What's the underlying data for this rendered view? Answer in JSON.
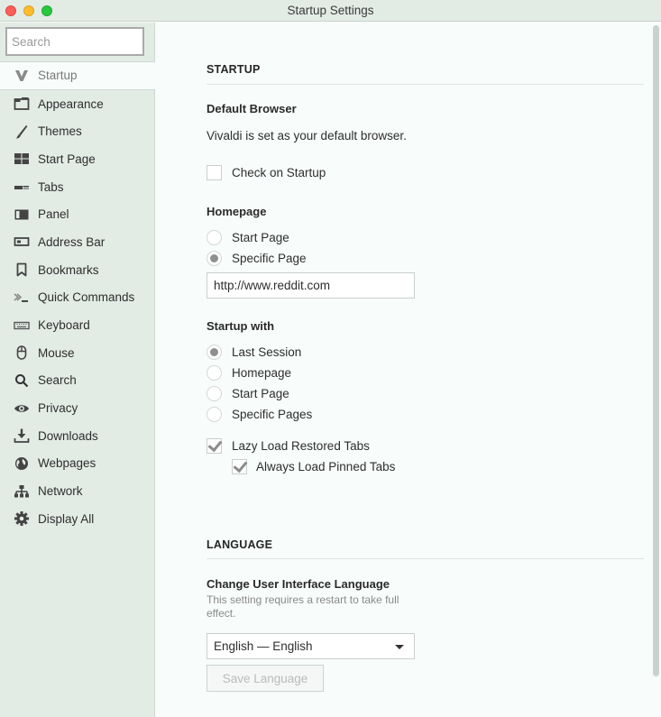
{
  "window": {
    "title": "Startup Settings"
  },
  "sidebar": {
    "search_placeholder": "Search",
    "items": [
      {
        "label": "Startup",
        "icon": "vivaldi-logo-icon",
        "selected": true
      },
      {
        "label": "Appearance",
        "icon": "window-icon"
      },
      {
        "label": "Themes",
        "icon": "brush-icon"
      },
      {
        "label": "Start Page",
        "icon": "grid-icon"
      },
      {
        "label": "Tabs",
        "icon": "tabs-icon"
      },
      {
        "label": "Panel",
        "icon": "panel-icon"
      },
      {
        "label": "Address Bar",
        "icon": "address-bar-icon"
      },
      {
        "label": "Bookmarks",
        "icon": "bookmark-icon"
      },
      {
        "label": "Quick Commands",
        "icon": "terminal-icon"
      },
      {
        "label": "Keyboard",
        "icon": "keyboard-icon"
      },
      {
        "label": "Mouse",
        "icon": "mouse-icon"
      },
      {
        "label": "Search",
        "icon": "search-icon"
      },
      {
        "label": "Privacy",
        "icon": "eye-icon"
      },
      {
        "label": "Downloads",
        "icon": "download-icon"
      },
      {
        "label": "Webpages",
        "icon": "globe-icon"
      },
      {
        "label": "Network",
        "icon": "network-icon"
      },
      {
        "label": "Display All",
        "icon": "gear-icon"
      }
    ]
  },
  "startup": {
    "section_title": "STARTUP",
    "default_browser": {
      "heading": "Default Browser",
      "status": "Vivaldi is set as your default browser.",
      "check_on_startup": {
        "label": "Check on Startup",
        "checked": false
      }
    },
    "homepage": {
      "heading": "Homepage",
      "options": [
        {
          "label": "Start Page",
          "checked": false
        },
        {
          "label": "Specific Page",
          "checked": true
        }
      ],
      "url_value": "http://www.reddit.com"
    },
    "startup_with": {
      "heading": "Startup with",
      "options": [
        {
          "label": "Last Session",
          "checked": true
        },
        {
          "label": "Homepage",
          "checked": false
        },
        {
          "label": "Start Page",
          "checked": false
        },
        {
          "label": "Specific Pages",
          "checked": false
        }
      ],
      "lazy_load": {
        "label": "Lazy Load Restored Tabs",
        "checked": true
      },
      "always_load_pinned": {
        "label": "Always Load Pinned Tabs",
        "checked": true
      }
    }
  },
  "language": {
    "section_title": "LANGUAGE",
    "heading": "Change User Interface Language",
    "note": "This setting requires a restart to take full effect.",
    "selected": "English — English",
    "save_label": "Save Language"
  }
}
